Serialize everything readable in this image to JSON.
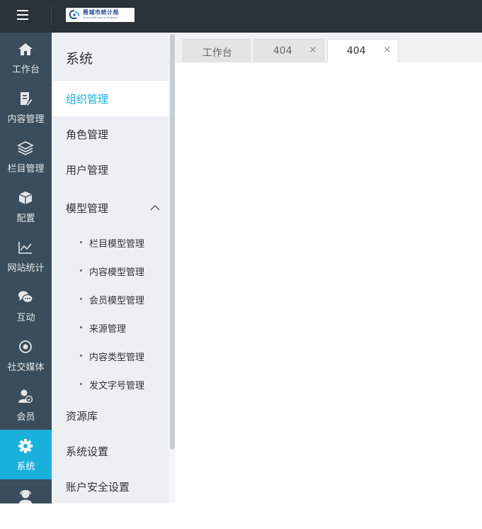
{
  "header": {
    "logo_text": "晋城市统计局",
    "logo_sub": "Jincheng Bureau of Statistics"
  },
  "rail": {
    "items": [
      {
        "label": "工作台",
        "icon": "home-icon"
      },
      {
        "label": "内容管理",
        "icon": "document-edit-icon"
      },
      {
        "label": "栏目管理",
        "icon": "layers-icon"
      },
      {
        "label": "配置",
        "icon": "cube-icon"
      },
      {
        "label": "网站统计",
        "icon": "line-chart-icon"
      },
      {
        "label": "互动",
        "icon": "chat-bubbles-icon"
      },
      {
        "label": "社交媒体",
        "icon": "target-icon"
      },
      {
        "label": "会员",
        "icon": "user-badge-icon"
      },
      {
        "label": "系统",
        "icon": "gear-icon",
        "active": true
      },
      {
        "label": "",
        "icon": "support-agent-icon"
      }
    ],
    "active_color": "#1ab0dc"
  },
  "submenu": {
    "title": "系统",
    "items": [
      {
        "label": "组织管理",
        "active": true
      },
      {
        "label": "角色管理"
      },
      {
        "label": "用户管理"
      },
      {
        "label": "模型管理",
        "expanded": true
      }
    ],
    "model_children": [
      {
        "label": "栏目模型管理"
      },
      {
        "label": "内容模型管理"
      },
      {
        "label": "会员模型管理"
      },
      {
        "label": "来源管理"
      },
      {
        "label": "内容类型管理"
      },
      {
        "label": "发文字号管理"
      }
    ],
    "bottom_items": [
      {
        "label": "资源库"
      },
      {
        "label": "系统设置"
      },
      {
        "label": "账户安全设置"
      }
    ]
  },
  "tabs": [
    {
      "label": "工作台",
      "closable": false
    },
    {
      "label": "404",
      "closable": true,
      "close": "×"
    },
    {
      "label": "404",
      "closable": true,
      "close": "×",
      "active": true
    }
  ]
}
